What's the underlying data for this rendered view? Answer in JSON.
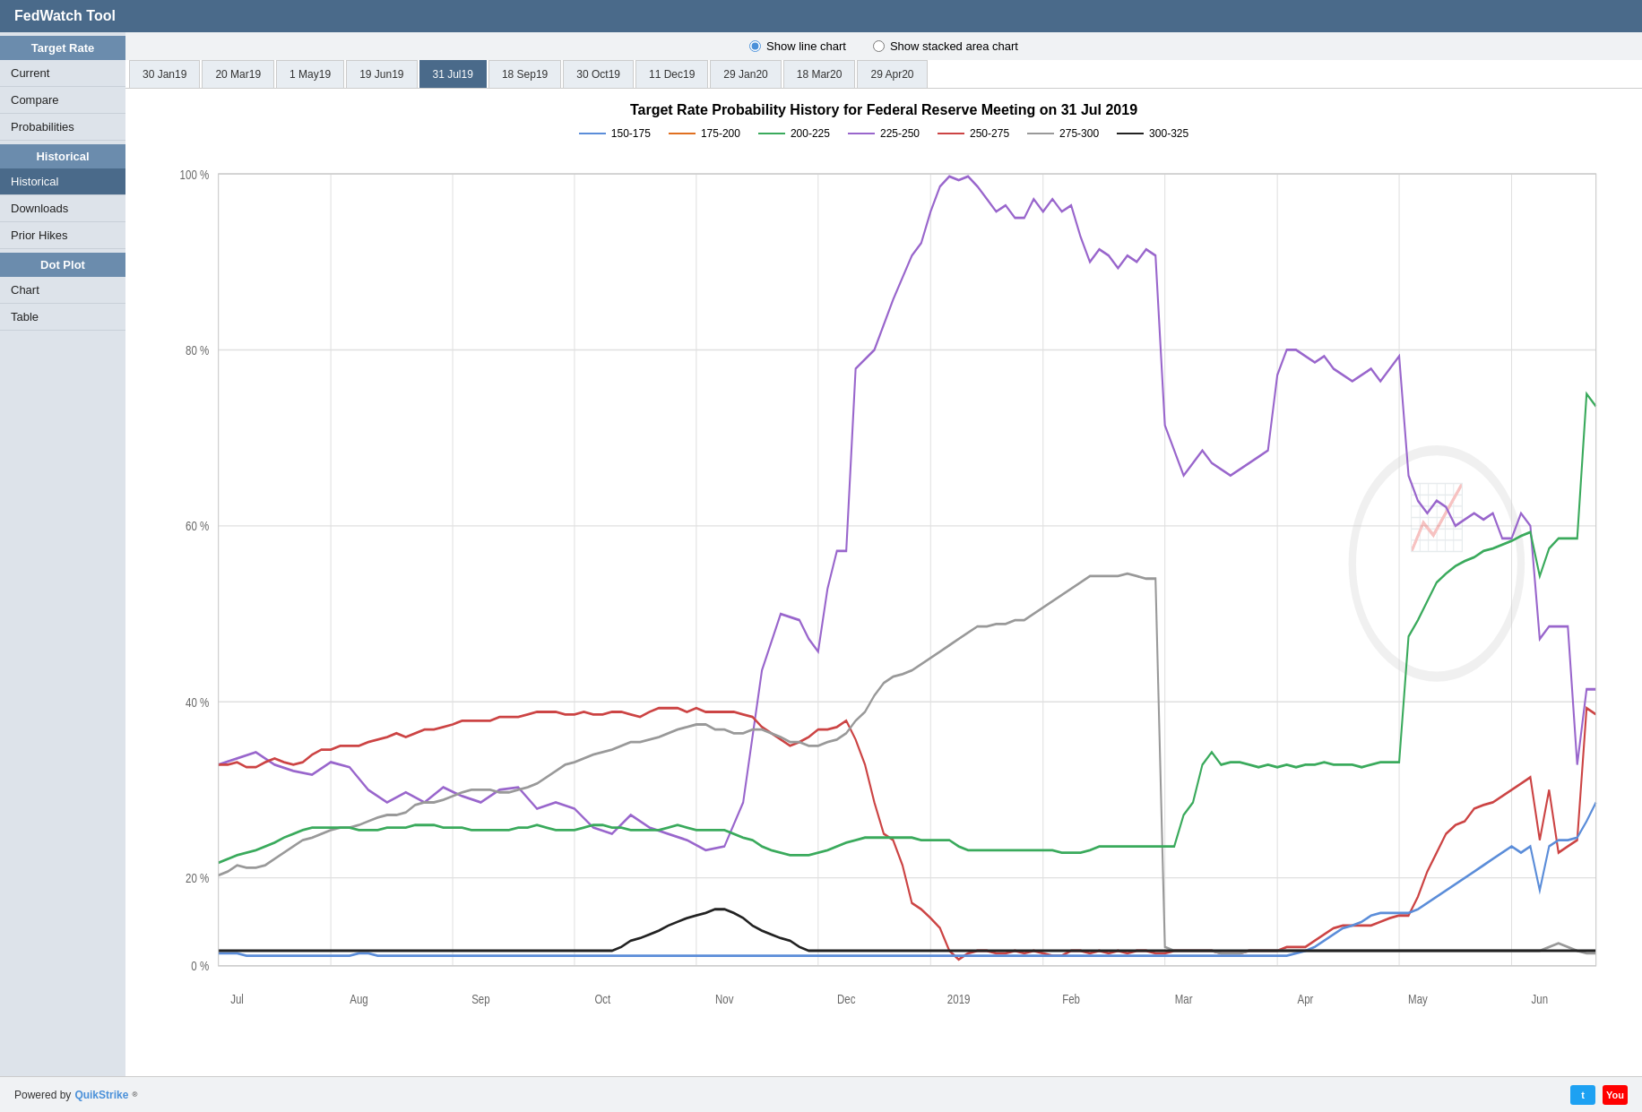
{
  "app": {
    "title": "FedWatch Tool"
  },
  "controls": {
    "radio_line": "Show line chart",
    "radio_stacked": "Show stacked area chart",
    "selected": "line"
  },
  "tabs": [
    {
      "label": "30 Jan19",
      "active": false
    },
    {
      "label": "20 Mar19",
      "active": false
    },
    {
      "label": "1 May19",
      "active": false
    },
    {
      "label": "19 Jun19",
      "active": false
    },
    {
      "label": "31 Jul19",
      "active": true
    },
    {
      "label": "18 Sep19",
      "active": false
    },
    {
      "label": "30 Oct19",
      "active": false
    },
    {
      "label": "11 Dec19",
      "active": false
    },
    {
      "label": "29 Jan20",
      "active": false
    },
    {
      "label": "18 Mar20",
      "active": false
    },
    {
      "label": "29 Apr20",
      "active": false
    }
  ],
  "sidebar": {
    "target_rate_header": "Target Rate",
    "target_rate_items": [
      {
        "label": "Current",
        "active": false
      },
      {
        "label": "Compare",
        "active": false
      },
      {
        "label": "Probabilities",
        "active": false
      }
    ],
    "historical_header": "Historical",
    "historical_items": [
      {
        "label": "Historical",
        "active": true
      },
      {
        "label": "Downloads",
        "active": false
      },
      {
        "label": "Prior Hikes",
        "active": false
      }
    ],
    "dot_plot_header": "Dot Plot",
    "dot_plot_items": [
      {
        "label": "Chart",
        "active": false
      },
      {
        "label": "Table",
        "active": false
      }
    ]
  },
  "chart": {
    "title": "Target Rate Probability History for Federal Reserve Meeting on 31 Jul 2019",
    "legend": [
      {
        "label": "150-175",
        "color": "#5b8dd9"
      },
      {
        "label": "175-200",
        "color": "#e07020"
      },
      {
        "label": "200-225",
        "color": "#3aaa5c"
      },
      {
        "label": "225-250",
        "color": "#9966cc"
      },
      {
        "label": "250-275",
        "color": "#cc4444"
      },
      {
        "label": "275-300",
        "color": "#999999"
      },
      {
        "label": "300-325",
        "color": "#222222"
      }
    ],
    "y_axis": [
      "100 %",
      "80 %",
      "60 %",
      "40 %",
      "20 %",
      "0 %"
    ],
    "x_axis": [
      "Jul",
      "Aug",
      "Sep",
      "Oct",
      "Nov",
      "Dec",
      "2019",
      "Feb",
      "Mar",
      "Apr",
      "May",
      "Jun"
    ]
  },
  "footer": {
    "powered_by": "Powered by",
    "brand": "QuikStrike",
    "registered": "®",
    "twitter_label": "t",
    "youtube_label": "You"
  }
}
